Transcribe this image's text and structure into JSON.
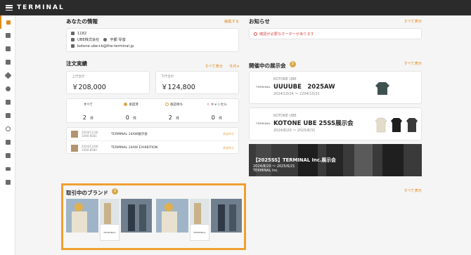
{
  "app": {
    "logo": "TERMINAL"
  },
  "sidebar": {
    "items": [
      "dashboard",
      "list",
      "document",
      "document2",
      "tag",
      "chat",
      "card",
      "gift",
      "help",
      "megaphone",
      "id",
      "monitor",
      "logout"
    ]
  },
  "profile": {
    "title": "あなたの情報",
    "edit_link": "編集する",
    "code": "1182",
    "company": "UBE株式会社",
    "person": "宇都 琴音",
    "email": "kotone.ube+b@the-terminal.jp"
  },
  "news": {
    "title": "お知らせ",
    "see_all": "すべて表示",
    "alert": "確認が必要なオーダーがあります"
  },
  "orders": {
    "title": "注文実績",
    "see_all": "すべて表示",
    "period": "今月",
    "upper_label": "上代合計",
    "upper_value": "￥208,000",
    "lower_label": "下代合計",
    "lower_value": "￥124,800",
    "statuses": [
      {
        "label": "すべて",
        "value": "2",
        "unit": "件"
      },
      {
        "label": "承認済",
        "value": "0",
        "unit": "件"
      },
      {
        "label": "承認待ち",
        "value": "2",
        "unit": "件"
      },
      {
        "label": "キャンセル",
        "value": "0",
        "unit": "件"
      }
    ],
    "rows": [
      {
        "date": "2024/11/18",
        "code": "1000-8581",
        "name": "TERMINAL 24AW展示会",
        "status": "承認待ち"
      },
      {
        "date": "2024/11/08",
        "code": "1000-8580",
        "name": "TERMINAL 24AW EXHIBITION",
        "status": "承認待ち"
      }
    ]
  },
  "exhibitions": {
    "title": "開催中の展示会",
    "count": "3",
    "see_all": "すべて表示",
    "items": [
      {
        "brand": "KOTONE UBE",
        "name": "UUUUBE　2025AW",
        "period": "2024/10/24 〜 2204/10/31",
        "logo": "TERMINAL"
      },
      {
        "brand": "KOTONE UBE",
        "name": "KOTONE UBE 25SS展示会",
        "period": "2024/8/20 〜 2025/8/31",
        "logo": "TERMINAL"
      },
      {
        "name": "【2025SS】TERMINAL Inc.展示会",
        "period": "2024/8/20 〜 2025/6/21",
        "company": "TERMINAL Inc."
      }
    ]
  },
  "brands": {
    "title": "取引中のブランド",
    "count": "2",
    "see_all": "すべて表示",
    "logo": "TERMINAL"
  },
  "colors": {
    "accent": "#e08a1e",
    "topbar": "#2b2b2b",
    "alert": "#d9534f"
  }
}
